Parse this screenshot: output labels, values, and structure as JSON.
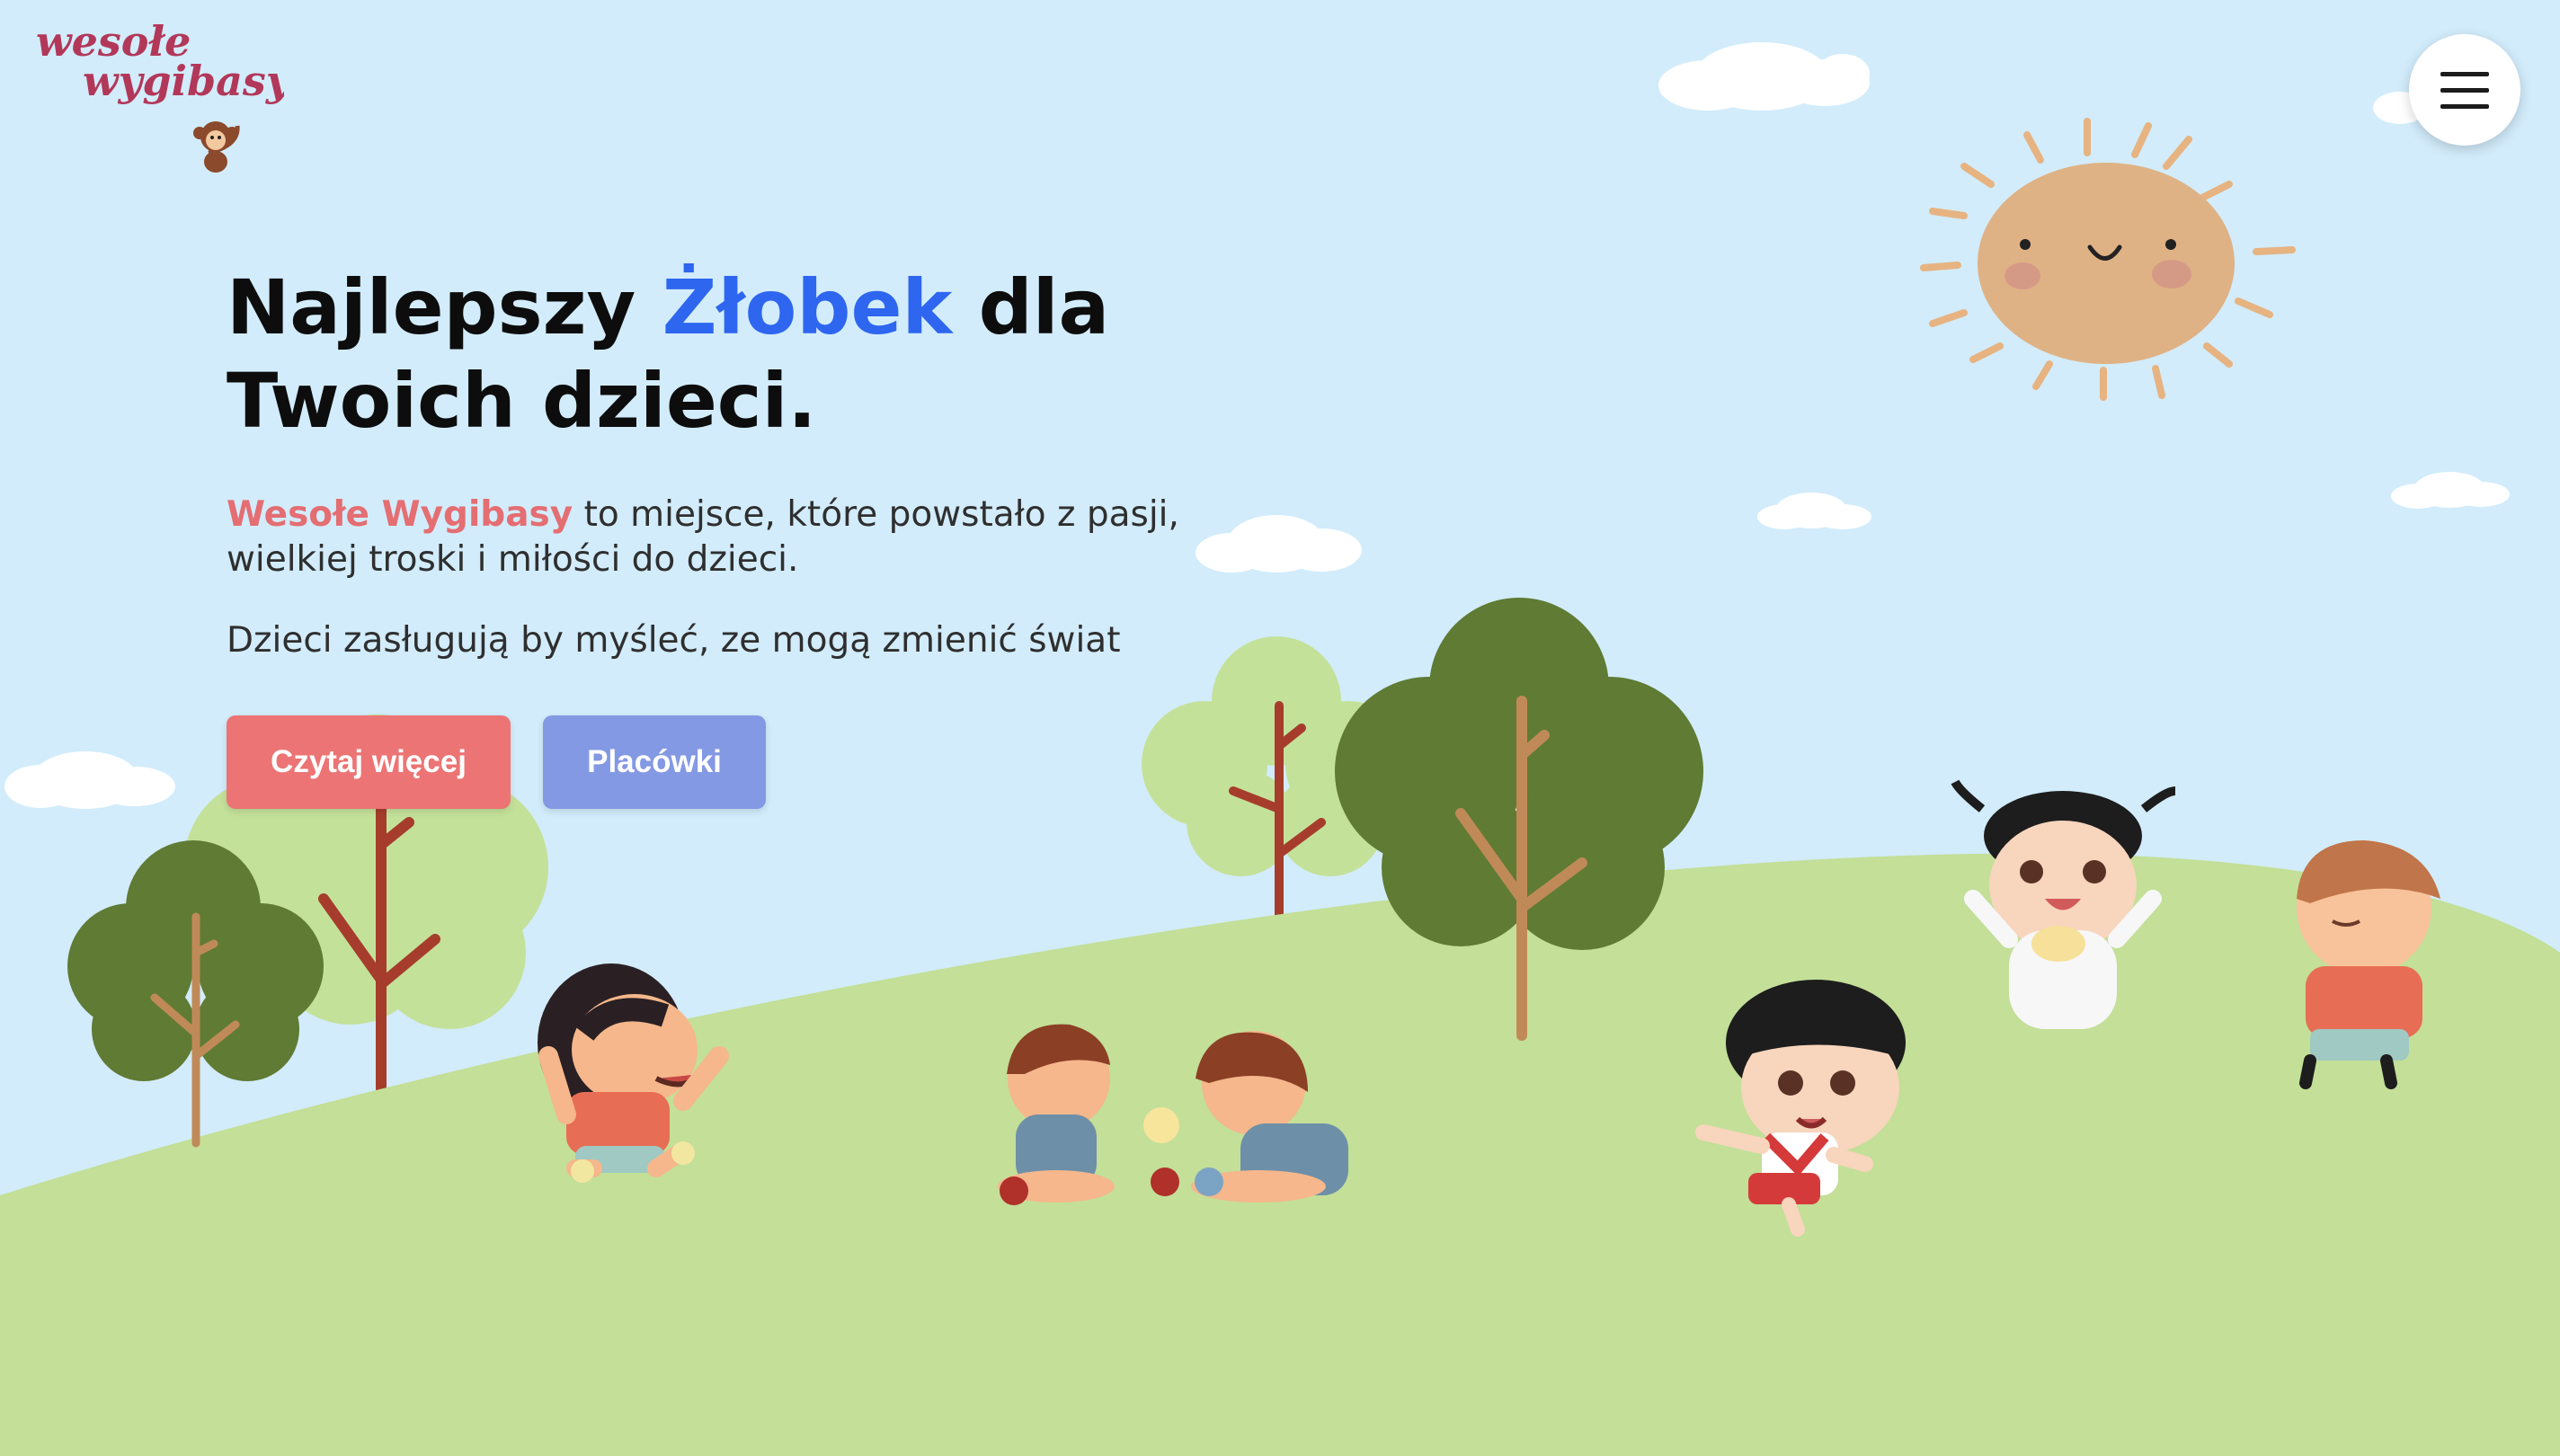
{
  "logo": {
    "line1": "wesołe",
    "line2": "wygibasy"
  },
  "menu": {
    "icon": "hamburger-menu-icon"
  },
  "hero": {
    "headline_pre": "Najlepszy ",
    "headline_highlight": "Żłobek",
    "headline_post": " dla Twoich dzieci.",
    "intro_brand": "Wesołe Wygibasy",
    "intro_rest": " to miejsce, które powstało z pasji, wielkiej troski i miłości do dzieci.",
    "tagline": "Dzieci zasługują by myśleć, ze mogą zmienić świat"
  },
  "buttons": {
    "read_more": "Czytaj więcej",
    "locations": "Placówki"
  },
  "colors": {
    "sky": "#d2ecfb",
    "grass": "#c3df98",
    "highlight_blue": "#2e66f0",
    "brand_pink": "#e46e72",
    "button_red": "#ec7474",
    "button_blue": "#8499e3",
    "logo": "#b2385a"
  }
}
